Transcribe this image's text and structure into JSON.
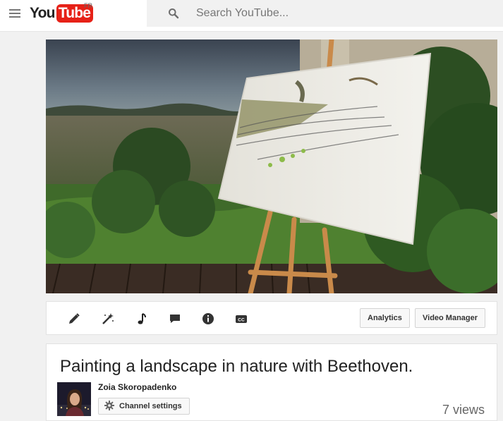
{
  "masthead": {
    "logo_you": "You",
    "logo_tube": "Tube",
    "country_code": "FR",
    "search_placeholder": "Search YouTube..."
  },
  "creator_bar": {
    "analytics_label": "Analytics",
    "video_manager_label": "Video Manager",
    "icons": [
      "pencil-icon",
      "magic-wand-icon",
      "music-note-icon",
      "comment-icon",
      "info-icon",
      "closed-captions-icon"
    ]
  },
  "video": {
    "title": "Painting a landscape in nature with Beethoven.",
    "channel_name": "Zoia Skoropadenko",
    "channel_settings_label": "Channel settings",
    "view_count": "7 views"
  },
  "colors": {
    "brand_red": "#e62117",
    "page_background": "#f1f1f1",
    "card_background": "#ffffff"
  }
}
